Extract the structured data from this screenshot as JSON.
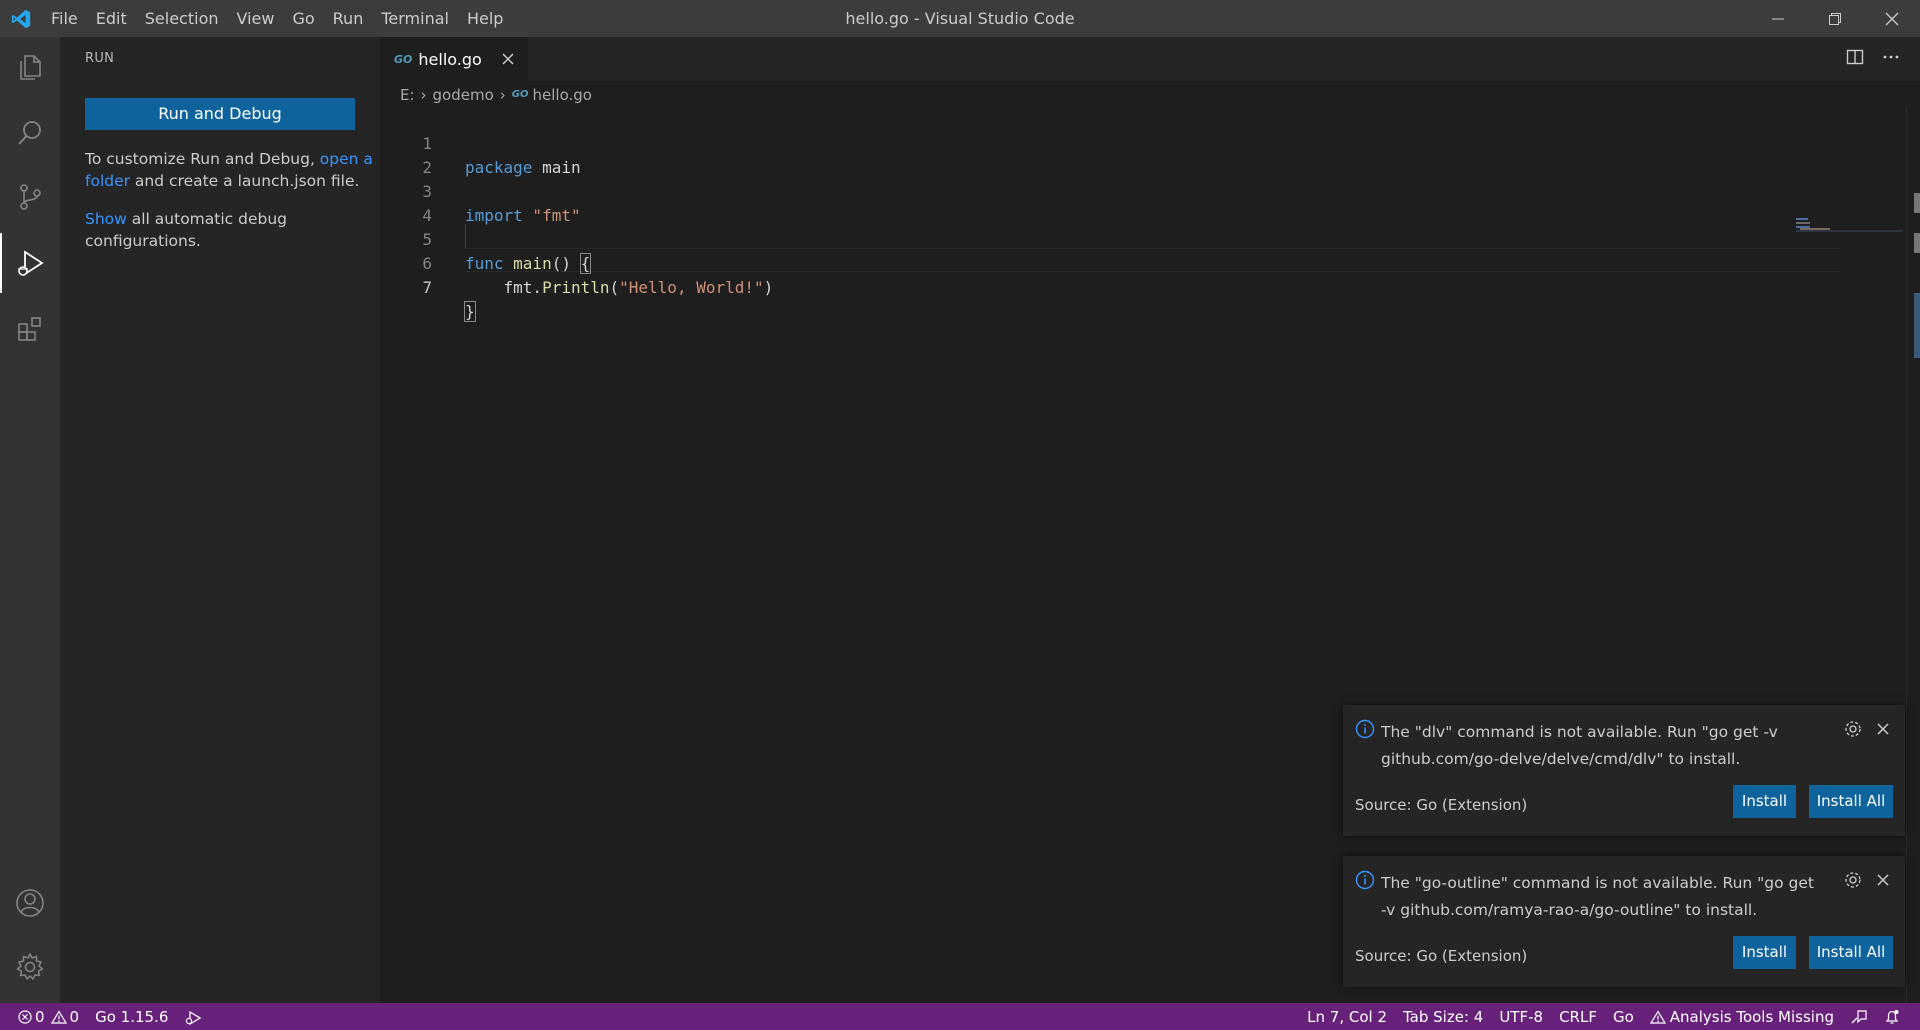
{
  "window": {
    "title": "hello.go - Visual Studio Code"
  },
  "menu": [
    "File",
    "Edit",
    "Selection",
    "View",
    "Go",
    "Run",
    "Terminal",
    "Help"
  ],
  "activity_bar": {
    "items": [
      "explorer-icon",
      "search-icon",
      "source-control-icon",
      "run-debug-icon",
      "extensions-icon"
    ],
    "bottom": [
      "account-icon",
      "manage-gear-icon"
    ]
  },
  "sidebar": {
    "title": "RUN",
    "run_button": "Run and Debug",
    "customize_prefix": "To customize Run and Debug, ",
    "customize_link": "open a folder",
    "customize_suffix": " and create a launch.json file.",
    "show_link": "Show",
    "show_suffix": " all automatic debug configurations."
  },
  "tab": {
    "icon_text": "GO",
    "label": "hello.go"
  },
  "breadcrumbs": {
    "drive": "E:",
    "folder": "godemo",
    "file": "hello.go"
  },
  "code": {
    "line_numbers": [
      "1",
      "2",
      "3",
      "4",
      "5",
      "6",
      "7"
    ],
    "l1_kw": "package",
    "l1_name": " main",
    "l3_kw": "import",
    "l3_str": " \"fmt\"",
    "l5_kw": "func",
    "l5_fn": " main",
    "l5_rest": "() ",
    "l5_brace": "{",
    "l6_pkg": "    fmt.",
    "l6_fn": "Println",
    "l6_open": "(",
    "l6_str": "\"Hello, World!\"",
    "l6_close": ")",
    "l7_brace": "}"
  },
  "notifications": [
    {
      "message": "The \"dlv\" command is not available. Run \"go get -v github.com/go-delve/delve/cmd/dlv\" to install.",
      "source": "Source: Go (Extension)",
      "install": "Install",
      "install_all": "Install All"
    },
    {
      "message": "The \"go-outline\" command is not available. Run \"go get -v github.com/ramya-rao-a/go-outline\" to install.",
      "source": "Source: Go (Extension)",
      "install": "Install",
      "install_all": "Install All"
    }
  ],
  "status_bar": {
    "errors": "0",
    "warnings": "0",
    "go_version": "Go 1.15.6",
    "cursor": "Ln 7, Col 2",
    "tab_size": "Tab Size: 4",
    "encoding": "UTF-8",
    "eol": "CRLF",
    "language": "Go",
    "analysis": "Analysis Tools Missing"
  },
  "colors": {
    "status_bar": "#68217a",
    "button": "#0e639c",
    "link": "#3794ff",
    "title_bar": "#3c3c3c"
  }
}
